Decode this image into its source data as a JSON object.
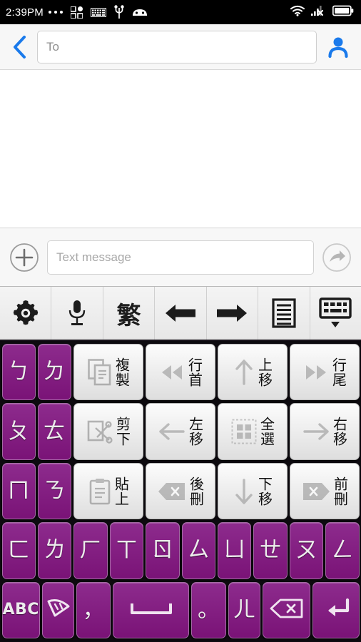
{
  "statusbar": {
    "time": "2:39PM",
    "icons": [
      "more-dots",
      "apps-grid-icon",
      "keyboard-icon",
      "usb-icon",
      "android-robot-icon"
    ],
    "right_icons": [
      "wifi-icon",
      "cell-signal-no-service-icon",
      "battery-icon"
    ]
  },
  "header": {
    "back_label": "back",
    "to_placeholder": "To",
    "to_value": "",
    "contact_icon": "person-icon"
  },
  "compose": {
    "add_icon": "plus-circle-icon",
    "message_placeholder": "Text message",
    "message_value": "",
    "send_icon": "send-arrow-icon"
  },
  "keyboard_toolbar": {
    "buttons": [
      {
        "name": "settings",
        "icon": "gear-icon",
        "label": ""
      },
      {
        "name": "voice-input",
        "icon": "microphone-icon",
        "label": ""
      },
      {
        "name": "traditional-chinese-mode",
        "icon": "text-glyph",
        "label": "繁"
      },
      {
        "name": "move-left",
        "icon": "arrow-left-icon",
        "label": ""
      },
      {
        "name": "move-right",
        "icon": "arrow-right-icon",
        "label": ""
      },
      {
        "name": "candidate-list",
        "icon": "list-document-icon",
        "label": ""
      },
      {
        "name": "hide-keyboard",
        "icon": "keyboard-dropdown-icon",
        "label": ""
      }
    ]
  },
  "keyboard": {
    "bopomofo_left_column": [
      {
        "glyph": "ㄅ",
        "name": "key-bopomofo-b"
      },
      {
        "glyph": "ㄉ",
        "name": "key-bopomofo-d"
      },
      {
        "glyph": "ㄆ",
        "name": "key-bopomofo-p"
      },
      {
        "glyph": "ㄊ",
        "name": "key-bopomofo-t"
      },
      {
        "glyph": "ㄇ",
        "name": "key-bopomofo-m"
      },
      {
        "glyph": "ㄋ",
        "name": "key-bopomofo-n"
      }
    ],
    "function_grid": [
      {
        "label": "複製",
        "icon": "copy-icon",
        "name": "key-copy"
      },
      {
        "label": "行首",
        "icon": "rewind-icon",
        "name": "key-line-start"
      },
      {
        "label": "上移",
        "icon": "arrow-up-icon",
        "name": "key-move-up"
      },
      {
        "label": "行尾",
        "icon": "fast-forward-icon",
        "name": "key-line-end"
      },
      {
        "label": "剪下",
        "icon": "cut-icon",
        "name": "key-cut"
      },
      {
        "label": "左移",
        "icon": "arrow-left-icon",
        "name": "key-move-left"
      },
      {
        "label": "全選",
        "icon": "select-all-icon",
        "name": "key-select-all"
      },
      {
        "label": "右移",
        "icon": "arrow-right-icon",
        "name": "key-move-right"
      },
      {
        "label": "貼上",
        "icon": "paste-icon",
        "name": "key-paste"
      },
      {
        "label": "後刪",
        "icon": "backspace-icon",
        "name": "key-backward-delete"
      },
      {
        "label": "下移",
        "icon": "arrow-down-icon",
        "name": "key-move-down"
      },
      {
        "label": "前刪",
        "icon": "forward-delete-icon",
        "name": "key-forward-delete"
      }
    ],
    "bopomofo_row": [
      {
        "glyph": "ㄈ",
        "name": "key-bopomofo-f"
      },
      {
        "glyph": "ㄌ",
        "name": "key-bopomofo-l"
      },
      {
        "glyph": "ㄏ",
        "name": "key-bopomofo-h"
      },
      {
        "glyph": "ㄒ",
        "name": "key-bopomofo-x"
      },
      {
        "glyph": "ㄖ",
        "name": "key-bopomofo-r"
      },
      {
        "glyph": "ㄙ",
        "name": "key-bopomofo-s"
      },
      {
        "glyph": "ㄩ",
        "name": "key-bopomofo-yu"
      },
      {
        "glyph": "ㄝ",
        "name": "key-bopomofo-e"
      },
      {
        "glyph": "ㄡ",
        "name": "key-bopomofo-ou"
      },
      {
        "glyph": "ㄥ",
        "name": "key-bopomofo-eng"
      }
    ],
    "bottom_row": [
      {
        "glyph": "ABC",
        "name": "key-abc-mode",
        "type": "text-small"
      },
      {
        "glyph": "",
        "name": "key-symbol-palette",
        "type": "icon-fan"
      },
      {
        "glyph": "，",
        "name": "key-comma",
        "type": "glyph"
      },
      {
        "glyph": "",
        "name": "key-space",
        "type": "icon-space"
      },
      {
        "glyph": "。",
        "name": "key-period",
        "type": "glyph"
      },
      {
        "glyph": "ㄦ",
        "name": "key-bopomofo-er",
        "type": "glyph"
      },
      {
        "glyph": "",
        "name": "key-backspace",
        "type": "icon-backspace"
      },
      {
        "glyph": "",
        "name": "key-enter",
        "type": "icon-enter"
      }
    ]
  },
  "colors": {
    "key_purple": "#7d1d7d",
    "accent_blue": "#1a7aeb",
    "keyboard_bg": "#0d0a0f",
    "toolbar_bg": "#eeeeee"
  }
}
